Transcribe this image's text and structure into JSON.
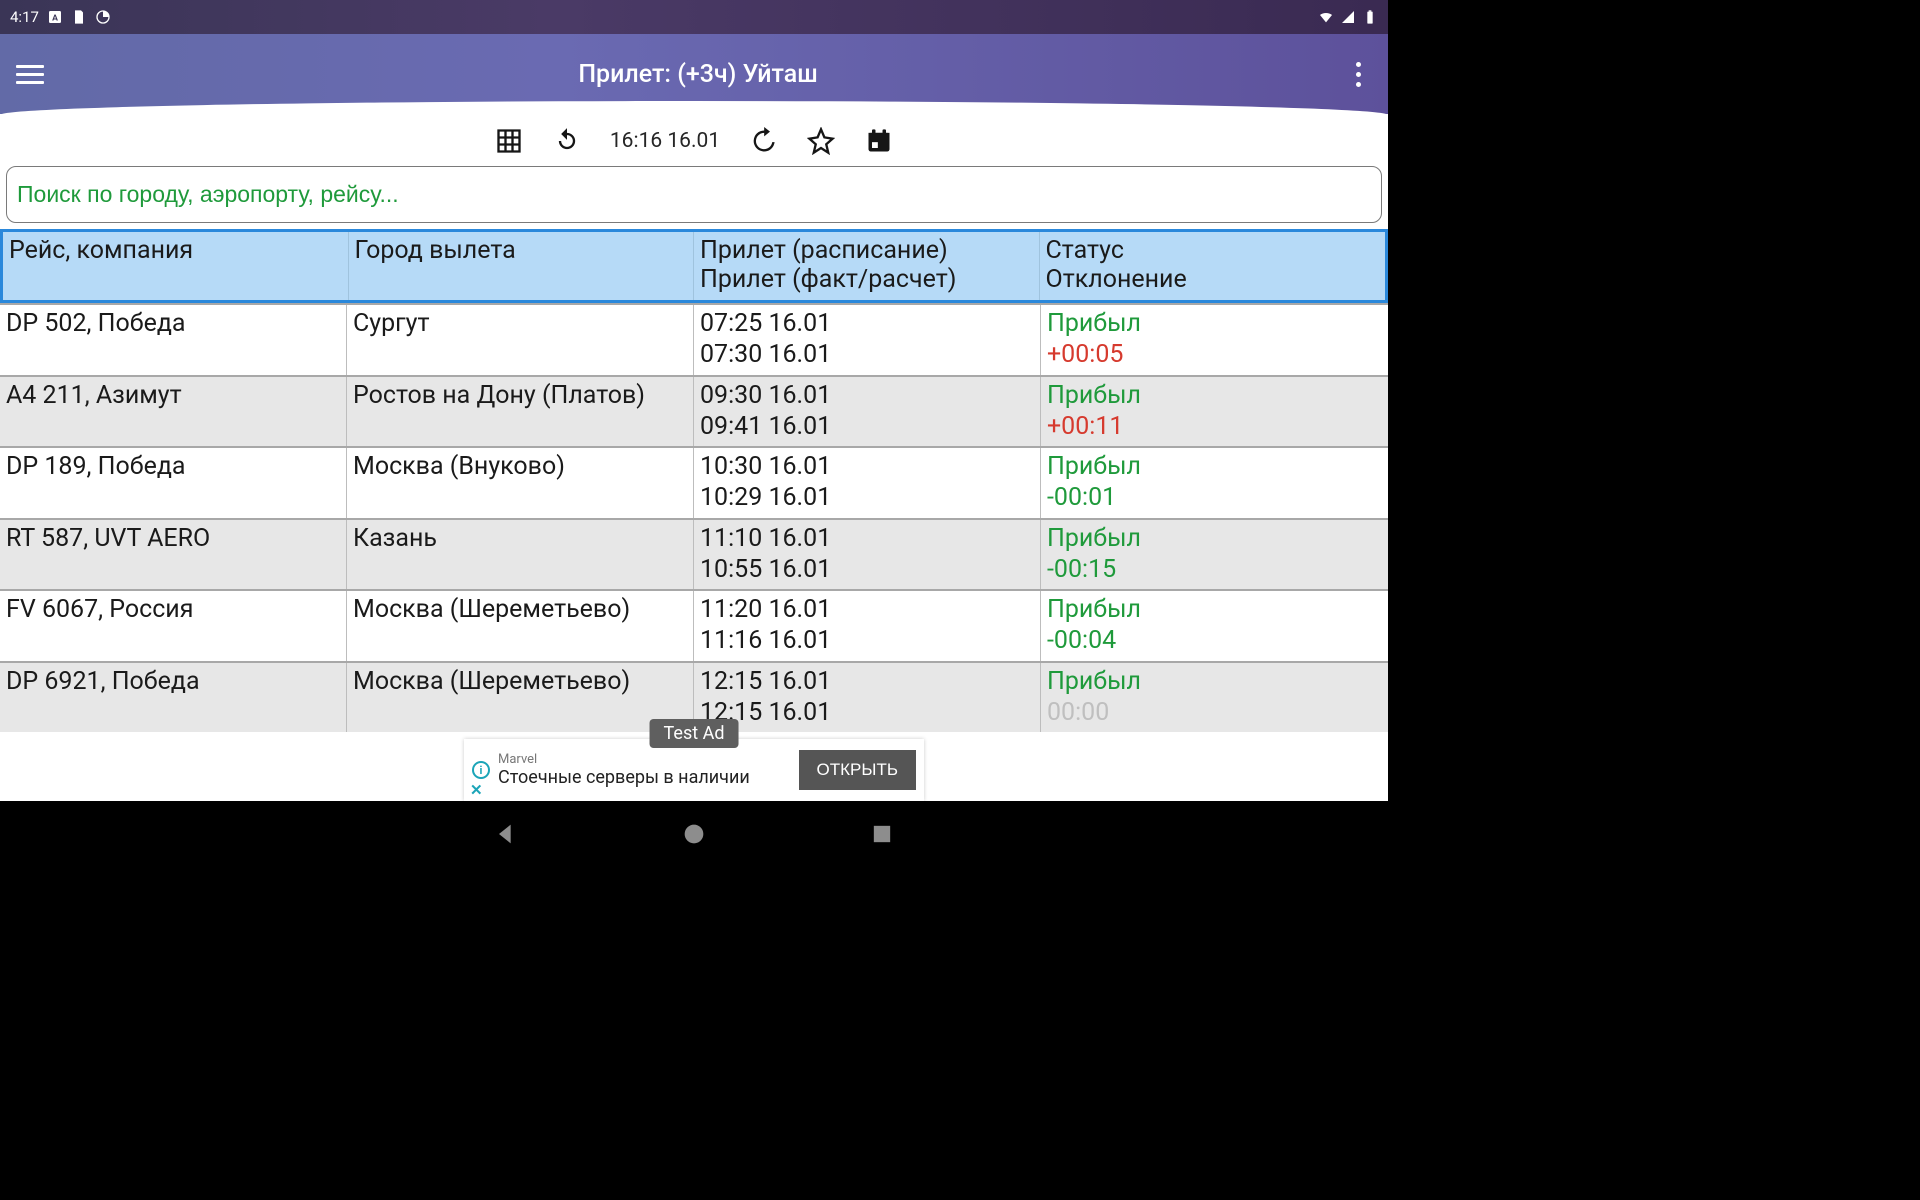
{
  "statusbar": {
    "time": "4:17"
  },
  "appbar": {
    "title": "Прилет: (+3ч) Уйташ"
  },
  "toolbar": {
    "timestamp": "16:16 16.01"
  },
  "search": {
    "placeholder": "Поиск по городу, аэропорту, рейсу..."
  },
  "headers": {
    "flight": "Рейс, компания",
    "city": "Город вылета",
    "arrival1": "Прилет (расписание)",
    "arrival2": "Прилет (факт/расчет)",
    "status1": "Статус",
    "status2": "Отклонение"
  },
  "rows": [
    {
      "flight": "DP 502, Победа",
      "city": "Сургут",
      "sched": "07:25 16.01",
      "fact": "07:30 16.01",
      "status": "Прибыл",
      "dev": "+00:05",
      "devClass": "red",
      "alt": false
    },
    {
      "flight": "A4 211, Азимут",
      "city": "Ростов на Дону (Платов)",
      "sched": "09:30 16.01",
      "fact": "09:41 16.01",
      "status": "Прибыл",
      "dev": "+00:11",
      "devClass": "red",
      "alt": true
    },
    {
      "flight": "DP 189, Победа",
      "city": "Москва (Внуково)",
      "sched": "10:30 16.01",
      "fact": "10:29 16.01",
      "status": "Прибыл",
      "dev": "-00:01",
      "devClass": "green",
      "alt": false
    },
    {
      "flight": "RT 587, UVT AERO",
      "city": "Казань",
      "sched": "11:10 16.01",
      "fact": "10:55 16.01",
      "status": "Прибыл",
      "dev": "-00:15",
      "devClass": "green",
      "alt": true
    },
    {
      "flight": "FV 6067, Россия",
      "city": "Москва (Шереметьево)",
      "sched": "11:20 16.01",
      "fact": "11:16 16.01",
      "status": "Прибыл",
      "dev": "-00:04",
      "devClass": "green",
      "alt": false
    },
    {
      "flight": "DP 6921, Победа",
      "city": "Москва (Шереметьево)",
      "sched": "12:15 16.01",
      "fact": "12:15 16.01",
      "status": "Прибыл",
      "dev": "00:00",
      "devClass": "gray",
      "alt": true
    }
  ],
  "ad": {
    "brand": "Marvel",
    "line": "Стоечные серверы в наличии",
    "button": "ОТКРЫТЬ",
    "badge": "Test Ad"
  }
}
